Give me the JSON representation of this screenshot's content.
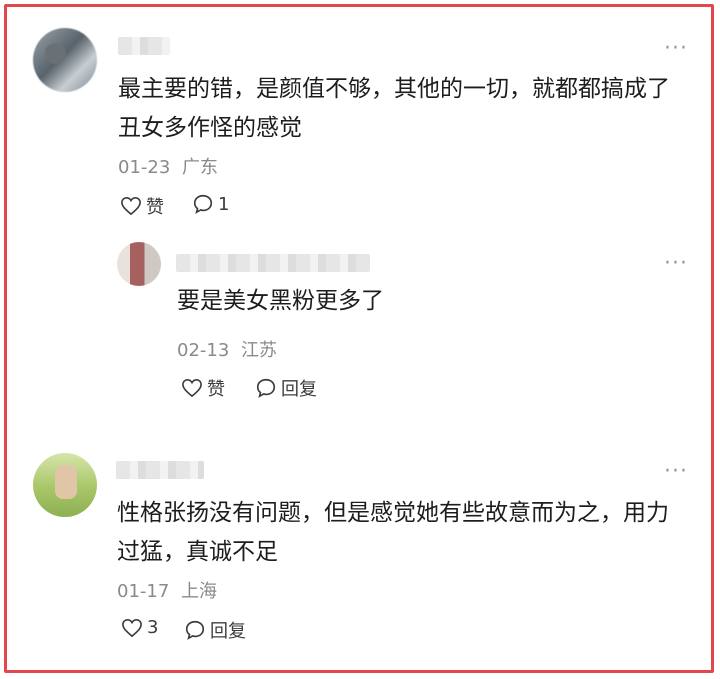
{
  "comments": [
    {
      "text": "最主要的错，是颜值不够，其他的一切，就都都搞成了\n丑女多作怪的感觉",
      "date": "01-23",
      "location": "广东",
      "like_label": "赞",
      "reply_label": "1",
      "reply": {
        "text": "要是美女黑粉更多了",
        "date": "02-13",
        "location": "江苏",
        "like_label": "赞",
        "reply_label": "回复"
      }
    },
    {
      "text": "性格张扬没有问题，但是感觉她有些故意而为之，用力\n过猛，真诚不足",
      "date": "01-17",
      "location": "上海",
      "like_label": "3",
      "reply_label": "回复"
    }
  ],
  "icons": {
    "more": "more-dots-icon",
    "like": "heart-icon",
    "reply": "speech-bubble-icon"
  },
  "colors": {
    "frame": "#e4474b",
    "text": "#1d1d1d",
    "meta": "#8a8a8a"
  }
}
